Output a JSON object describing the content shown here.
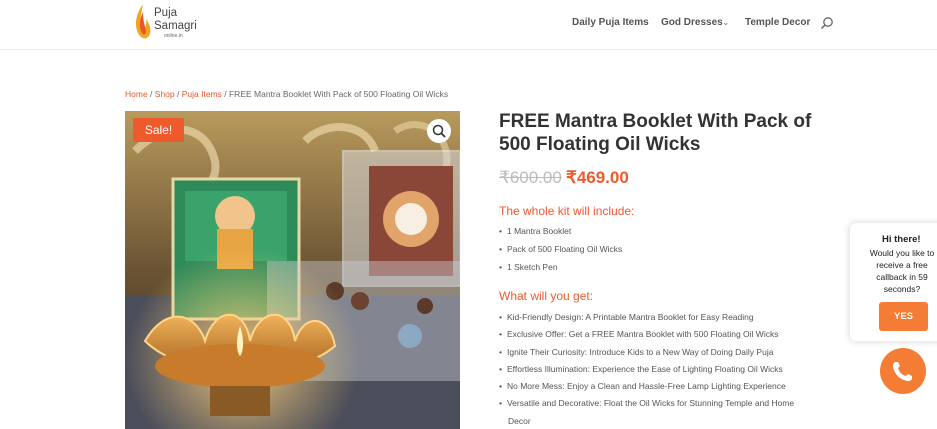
{
  "logo": {
    "line1": "Puja",
    "line2": "Samagri",
    "line3": "online.in"
  },
  "nav": {
    "item1": "Daily Puja Items",
    "item2": "God Dresses",
    "item3": "Temple Decor"
  },
  "breadcrumb": {
    "home": "Home",
    "sep": " / ",
    "shop": "Shop",
    "category": "Puja Items",
    "current": "FREE Mantra Booklet With Pack of 500 Floating Oil Wicks"
  },
  "product": {
    "sale_badge": "Sale!",
    "title": "FREE Mantra Booklet With Pack of 500 Floating Oil Wicks",
    "price_old": "₹600.00",
    "price_new": "₹469.00",
    "kit_heading": "The whole kit will include:",
    "kit_items": [
      "1 Mantra Booklet",
      "Pack of 500 Floating Oil Wicks",
      "1 Sketch Pen"
    ],
    "get_heading": "What will you get:",
    "get_items": [
      "Kid-Friendly Design: A Printable Mantra Booklet for Easy Reading",
      "Exclusive Offer: Get a FREE Mantra Booklet with 500 Floating Oil Wicks",
      "Ignite Their Curiosity: Introduce Kids to a New Way of Doing Daily Puja",
      "Effortless Illumination: Experience the Ease of Lighting Floating Oil Wicks",
      "No More Mess: Enjoy a Clean and Hassle-Free Lamp Lighting Experience",
      "Versatile and Decorative: Float the Oil Wicks for Stunning Temple and Home",
      "Decor"
    ]
  },
  "callback": {
    "heading": "Hi there!",
    "text": "Would you like to receive a free callback in 59 seconds?",
    "yes": "YES"
  },
  "colors": {
    "accent": "#ef5a2c",
    "widget": "#f57c34"
  }
}
